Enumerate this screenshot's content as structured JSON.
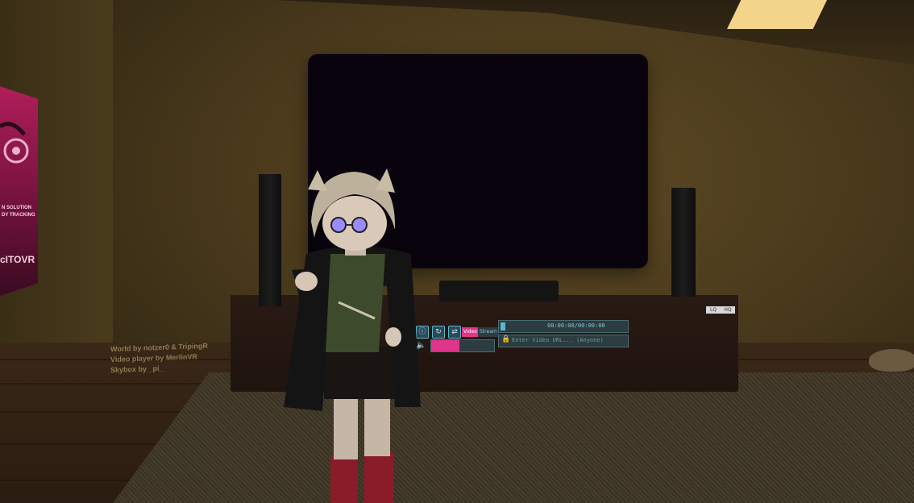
{
  "poster": {
    "line1": "N SOLUTION",
    "line2": "DY TRACKING",
    "brand": "cITOVR"
  },
  "credits": {
    "line1": "World by notzer0 & TripingR",
    "line2": "Video player by MerlinVR",
    "line3": "Skybox by _pi_"
  },
  "player": {
    "info_icon": "info-icon",
    "reload_icon": "reload-icon",
    "loop_icon": "loop-icon",
    "mode_video": "Video",
    "mode_stream": "Stream",
    "time": "00:00:00/00:00:00",
    "url_placeholder": "Enter Video URL... (Anyone)",
    "volume": 0.45,
    "accent": "#e0358a"
  },
  "quality": {
    "left": "LQ",
    "right": "HQ"
  }
}
